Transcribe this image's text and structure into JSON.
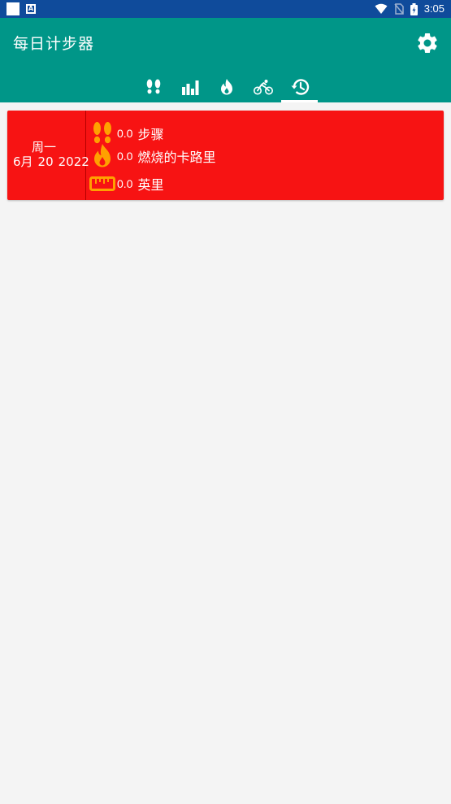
{
  "app": {
    "title": "每日计步器"
  },
  "status_bar": {
    "time": "3:05",
    "badge": "A"
  },
  "tabs": [
    {
      "name": "steps",
      "icon": "footprints-icon"
    },
    {
      "name": "stats",
      "icon": "bar-chart-icon"
    },
    {
      "name": "calories",
      "icon": "flame-icon"
    },
    {
      "name": "cycling",
      "icon": "bicycle-icon"
    },
    {
      "name": "history",
      "icon": "history-icon",
      "active": true
    }
  ],
  "history": [
    {
      "weekday": "周一",
      "month": "6月",
      "day": "20",
      "year": "2022",
      "steps": {
        "value": "0.0",
        "unit": "步骤"
      },
      "calories": {
        "value": "0.0",
        "unit": "燃烧的卡路里"
      },
      "distance": {
        "value": "0.0",
        "unit": "英里"
      }
    }
  ],
  "colors": {
    "status_bar": "#0f4b9b",
    "app_bar": "#009688",
    "card": "#f71313",
    "icon_accent": "#ffa000",
    "background": "#f4f4f4"
  }
}
